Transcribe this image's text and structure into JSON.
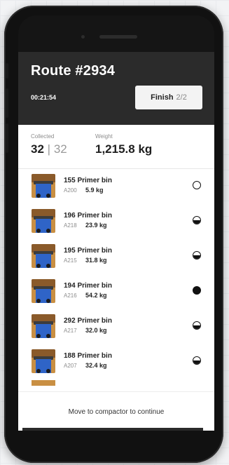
{
  "header": {
    "title": "Route #2934",
    "timer": "00:21:54",
    "finish_label": "Finish",
    "finish_count": "2/2"
  },
  "stats": {
    "collected_label": "Collected",
    "collected_value": "32",
    "collected_separator": "|",
    "collected_total": "32",
    "weight_label": "Weight",
    "weight_value": "1,215.8 kg"
  },
  "bins": [
    {
      "title": "155 Primer bin",
      "code": "A200",
      "weight": "5.9 kg",
      "status": "empty-icon"
    },
    {
      "title": "196 Primer bin",
      "code": "A218",
      "weight": "23.9 kg",
      "status": "half-full-icon"
    },
    {
      "title": "195 Primer bin",
      "code": "A215",
      "weight": "31.8 kg",
      "status": "half-full-icon"
    },
    {
      "title": "194 Primer bin",
      "code": "A216",
      "weight": "54.2 kg",
      "status": "full-icon"
    },
    {
      "title": "292 Primer bin",
      "code": "A217",
      "weight": "32.0 kg",
      "status": "half-full-icon"
    },
    {
      "title": "188 Primer bin",
      "code": "A207",
      "weight": "32.4 kg",
      "status": "half-full-icon"
    }
  ],
  "footer": {
    "message": "Move to compactor to continue"
  },
  "colors": {
    "header_bg": "#2b2b2b",
    "bin_body": "#2f64c7",
    "bin_frame": "#c98f43"
  }
}
